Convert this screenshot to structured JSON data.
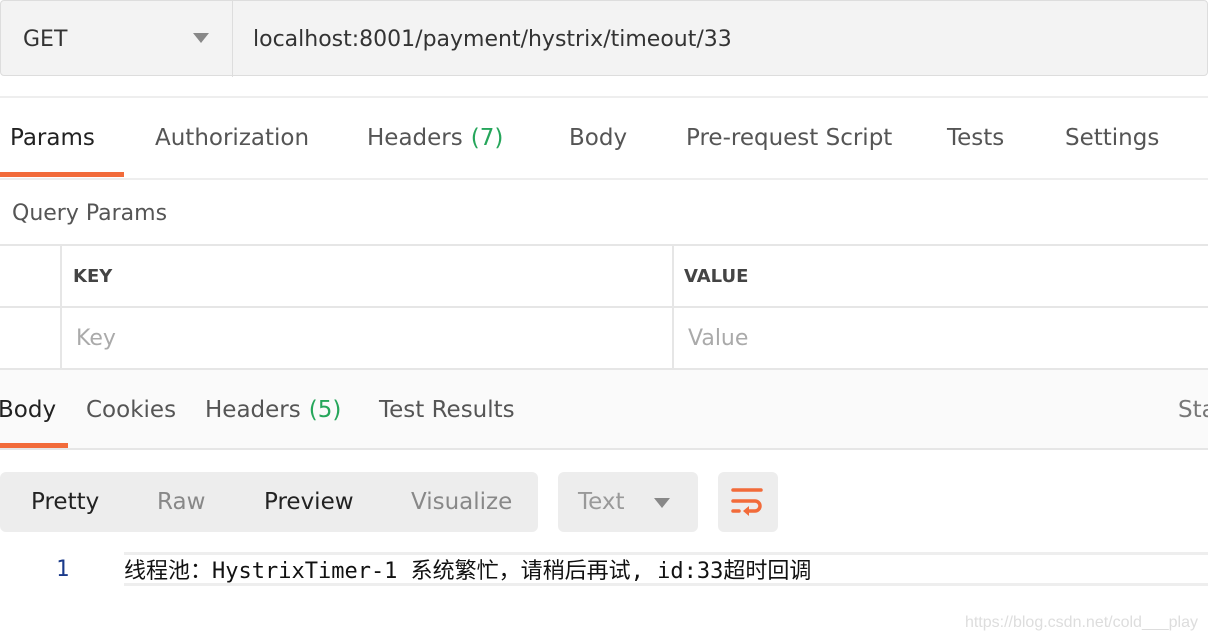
{
  "request": {
    "method": "GET",
    "url": "localhost:8001/payment/hystrix/timeout/33"
  },
  "request_tabs": [
    {
      "label": "Params"
    },
    {
      "label": "Authorization"
    },
    {
      "label": "Headers",
      "count": "(7)"
    },
    {
      "label": "Body"
    },
    {
      "label": "Pre-request Script"
    },
    {
      "label": "Tests"
    },
    {
      "label": "Settings"
    }
  ],
  "query_params": {
    "title": "Query Params",
    "columns": [
      "KEY",
      "VALUE"
    ],
    "placeholders": {
      "key": "Key",
      "value": "Value"
    }
  },
  "response_tabs": [
    {
      "label": "Body"
    },
    {
      "label": "Cookies"
    },
    {
      "label": "Headers",
      "count": "(5)"
    },
    {
      "label": "Test Results"
    }
  ],
  "status_label": "Sta",
  "view_modes": [
    "Pretty",
    "Raw",
    "Preview",
    "Visualize"
  ],
  "format": "Text",
  "body_lines": [
    {
      "number": "1",
      "text": "线程池：HystrixTimer-1 系统繁忙，请稍后再试, id:33超时回调"
    }
  ],
  "watermark": "https://blog.csdn.net/cold___play",
  "colors": {
    "accent": "#f26b3a",
    "count": "#26a65b"
  }
}
